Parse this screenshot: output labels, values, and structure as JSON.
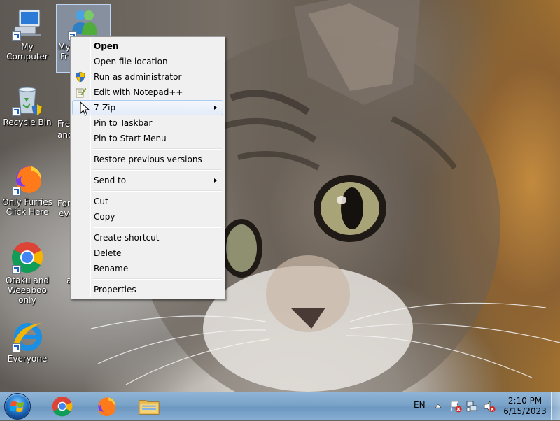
{
  "desktop": {
    "icons": [
      {
        "label": "My Computer",
        "icon": "computer-icon"
      },
      {
        "label": "Recycle Bin",
        "icon": "recycle-bin-icon"
      },
      {
        "label": "Only Furries Click Here",
        "icon": "firefox-icon"
      },
      {
        "label": "Otaku and Weeaboo only",
        "icon": "chrome-icon"
      },
      {
        "label": "Everyone",
        "icon": "internet-explorer-icon"
      }
    ],
    "selected_icon": {
      "label_fragment_1": "My",
      "label_fragment_2": "Fr",
      "icon": "users-icon"
    },
    "partial_labels": {
      "recycle_row_1": "Fre",
      "recycle_row_2": "and",
      "firefox_row_1": "For",
      "firefox_row_2": "eve",
      "chrome_row_1": "a"
    }
  },
  "context_menu": {
    "items": [
      {
        "label": "Open",
        "bold": true
      },
      {
        "label": "Open file location"
      },
      {
        "label": "Run as administrator",
        "icon": "uac-shield-icon"
      },
      {
        "label": "Edit with Notepad++",
        "icon": "notepad-plus-plus-icon"
      },
      {
        "label": "7-Zip",
        "submenu": true,
        "highlighted": true
      },
      {
        "label": "Pin to Taskbar"
      },
      {
        "label": "Pin to Start Menu"
      },
      {
        "label": "Restore previous versions"
      },
      {
        "label": "Send to",
        "submenu": true
      },
      {
        "label": "Cut"
      },
      {
        "label": "Copy"
      },
      {
        "label": "Create shortcut"
      },
      {
        "label": "Delete"
      },
      {
        "label": "Rename"
      },
      {
        "label": "Properties"
      }
    ]
  },
  "taskbar": {
    "pinned": [
      "chrome-icon",
      "firefox-icon",
      "file-explorer-icon"
    ],
    "language": "EN",
    "tray_icons": [
      "show-hidden-icons-icon",
      "action-center-icon",
      "network-icon",
      "volume-muted-icon"
    ],
    "time": "2:10 PM",
    "date": "6/15/2023"
  },
  "colors": {
    "menu_bg": "#f0f0f0",
    "menu_highlight_border": "#aecdf5",
    "taskbar": "#7aa3c9"
  }
}
